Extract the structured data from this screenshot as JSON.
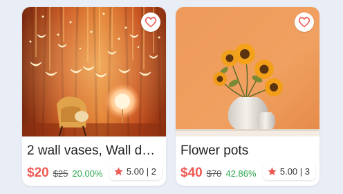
{
  "accent_color": "#ee5a55",
  "discount_color": "#2fa84f",
  "products": [
    {
      "title": "2 wall vases, Wall de…",
      "rating": "5.00 | 2",
      "price": "$20",
      "original_price": "$25",
      "discount": "20.00%",
      "image": "string-lights-armchair-photo",
      "favorite_icon": "heart-outline-icon",
      "rating_icon": "star-icon"
    },
    {
      "title": "Flower pots",
      "rating": "5.00 | 3",
      "price": "$40",
      "original_price": "$70",
      "discount": "42.86%",
      "image": "sunflower-vase-photo",
      "favorite_icon": "heart-outline-icon",
      "rating_icon": "star-icon"
    }
  ]
}
